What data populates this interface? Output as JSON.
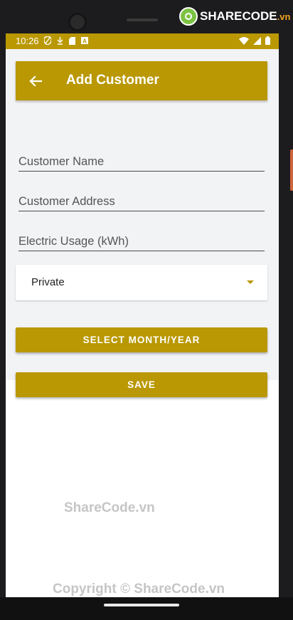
{
  "status_bar": {
    "time": "10:26",
    "icons": [
      "shield-icon",
      "download-icon",
      "sd-card-icon",
      "a-icon",
      "wifi-icon",
      "signal-icon",
      "battery-icon"
    ],
    "color": "#b99803"
  },
  "app_bar": {
    "title": "Add Customer",
    "back_icon": "arrow-left-icon",
    "color": "#b99803"
  },
  "form": {
    "customer_name": {
      "placeholder": "Customer Name",
      "value": ""
    },
    "customer_address": {
      "placeholder": "Customer Address",
      "value": ""
    },
    "electric_usage": {
      "placeholder": "Electric Usage (kWh)",
      "value": ""
    },
    "customer_type": {
      "selected": "Private"
    },
    "select_month_year_label": "SELECT MONTH/YEAR",
    "save_label": "SAVE"
  },
  "watermarks": {
    "logo_main": "SHARECODE",
    "logo_suffix": ".vn",
    "center": "ShareCode.vn",
    "bottom": "Copyright © ShareCode.vn"
  }
}
